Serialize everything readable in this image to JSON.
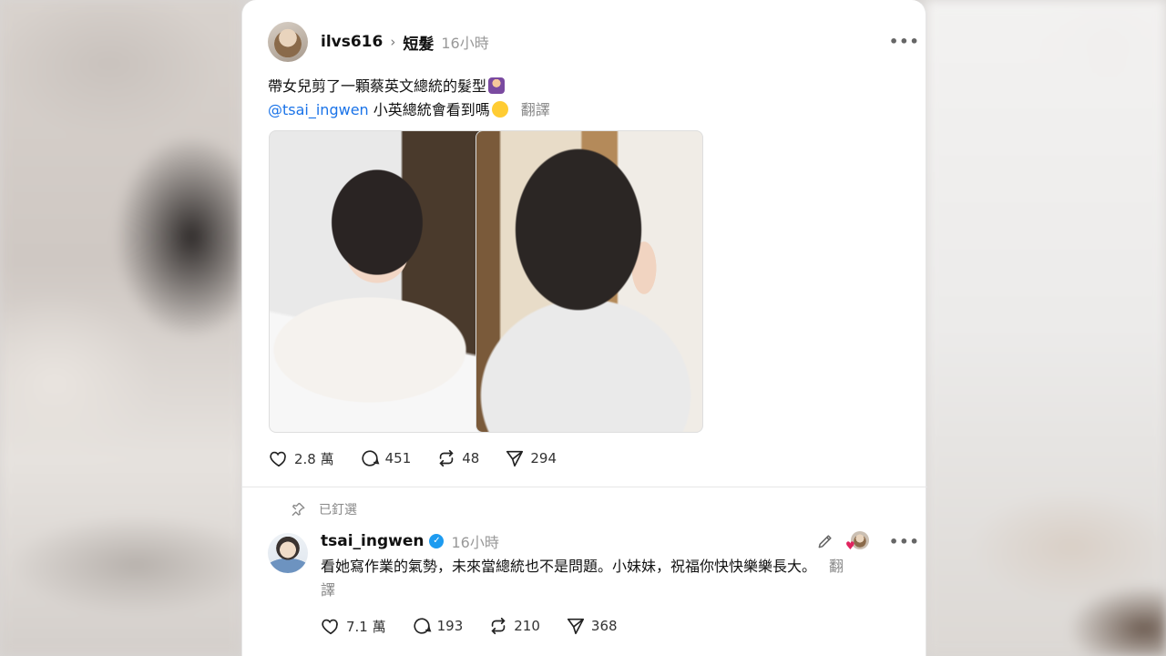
{
  "post": {
    "username": "ilvs616",
    "topic": "短髮",
    "time": "16小時",
    "more": "•••",
    "line1": "帶女兒剪了一顆蔡英文總統的髮型",
    "mention": "@tsai_ingwen",
    "line2": " 小英總統會看到嗎",
    "translate": "翻譯",
    "likes": "2.8 萬",
    "comments": "451",
    "reposts": "48",
    "shares": "294"
  },
  "reply": {
    "pinned_label": "已釘選",
    "username": "tsai_ingwen",
    "time": "16小時",
    "more": "•••",
    "text": "看她寫作業的氣勢，未來當總統也不是問題。小妹妹，祝福你快快樂樂長大。",
    "translate": "翻譯",
    "likes": "7.1 萬",
    "comments": "193",
    "reposts": "210",
    "shares": "368"
  },
  "icons": {
    "like": "heart-icon",
    "comment": "comment-icon",
    "repost": "repost-icon",
    "share": "send-icon",
    "pin": "pin-icon",
    "edit": "pencil-icon",
    "verified": "verified-badge-icon"
  },
  "colors": {
    "mention": "#1a73e8",
    "verified": "#1d9bf0",
    "muted": "#999999"
  }
}
